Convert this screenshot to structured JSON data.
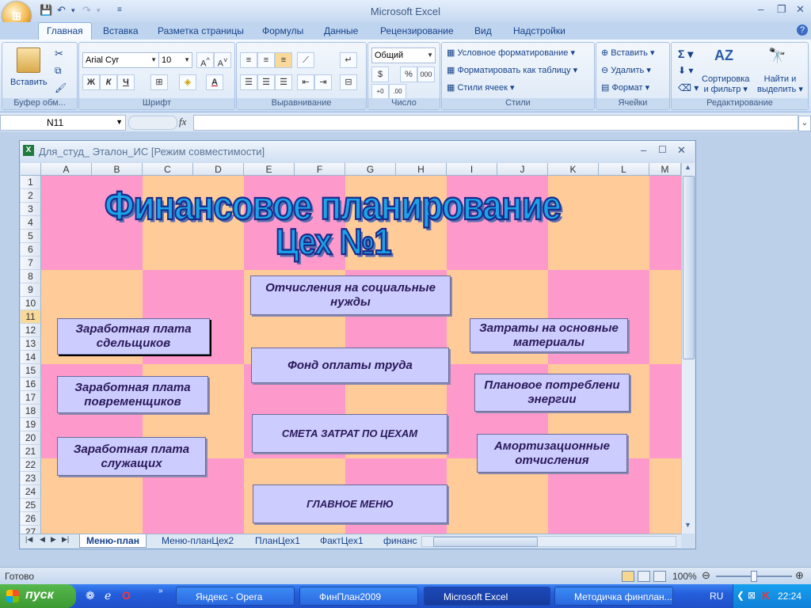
{
  "app": {
    "title": "Microsoft Excel"
  },
  "quick_access": {
    "save_icon": "save-icon",
    "undo_icon": "undo-icon",
    "redo_icon": "redo-icon"
  },
  "tabs": [
    "Главная",
    "Вставка",
    "Разметка страницы",
    "Формулы",
    "Данные",
    "Рецензирование",
    "Вид",
    "Надстройки"
  ],
  "ribbon": {
    "clipboard": {
      "label": "Буфер обм...",
      "paste": "Вставить"
    },
    "font": {
      "label": "Шрифт",
      "font_name": "Arial Cyr",
      "font_size": "10",
      "bold": "Ж",
      "italic": "К",
      "underline": "Ч"
    },
    "alignment": {
      "label": "Выравнивание"
    },
    "number": {
      "label": "Число",
      "format": "Общий",
      "percent": "%",
      "thousands": "000"
    },
    "styles": {
      "label": "Стили",
      "conditional": "Условное форматирование",
      "format_table": "Форматировать как таблицу",
      "cell_styles": "Стили ячеек"
    },
    "cells": {
      "label": "Ячейки",
      "insert": "Вставить",
      "delete": "Удалить",
      "format": "Формат"
    },
    "editing": {
      "label": "Редактирование",
      "sort_1": "Сортировка",
      "sort_2": "и фильтр",
      "find_1": "Найти и",
      "find_2": "выделить"
    }
  },
  "formula_bar": {
    "name_box": "N11",
    "fx": "fx",
    "formula": ""
  },
  "workbook": {
    "title": "Для_студ_ Эталон_ИС  [Режим совместимости]",
    "columns": [
      "A",
      "B",
      "C",
      "D",
      "E",
      "F",
      "G",
      "H",
      "I",
      "J",
      "K",
      "L",
      "M"
    ],
    "rows": [
      "1",
      "2",
      "3",
      "4",
      "5",
      "6",
      "7",
      "8",
      "9",
      "10",
      "11",
      "12",
      "13",
      "14",
      "15",
      "16",
      "17",
      "18",
      "19",
      "20",
      "21",
      "22",
      "23",
      "24",
      "25",
      "26",
      "27"
    ],
    "selected_row": "11",
    "title_line1": "Финансовое планирование",
    "title_line2": "Цех №1",
    "buttons": {
      "social": "Отчисления на социальные нужды",
      "piece_wage": "Заработная плата сдельщиков",
      "main_materials": "Затраты на основные материалы",
      "wage_fund": "Фонд оплаты труда",
      "time_wage": "Заработная плата повременщиков",
      "energy": "Плановое потреблени энергии",
      "cost_estimate": "СМЕТА ЗАТРАТ ПО ЦЕХАМ",
      "employee_wage": "Заработная плата служащих",
      "depreciation": "Амортизационные отчисления",
      "main_menu": "ГЛАВНОЕ МЕНЮ"
    },
    "sheet_tabs": [
      "Меню-план",
      "Меню-планЦех2",
      "ПланЦех1",
      "ФактЦех1",
      "финанс"
    ],
    "active_sheet": "Меню-план",
    "colors": {
      "pink": "#fe99cc",
      "peach": "#ffcc99",
      "button": "#ccccff"
    }
  },
  "status_bar": {
    "status": "Готово",
    "zoom": "100%"
  },
  "taskbar": {
    "start": "пуск",
    "tasks": [
      "Яндекс - Opera",
      "ФинПлан2009",
      "Microsoft Excel",
      "Методичка финплан..."
    ],
    "lang": "RU",
    "clock": "22:24"
  }
}
